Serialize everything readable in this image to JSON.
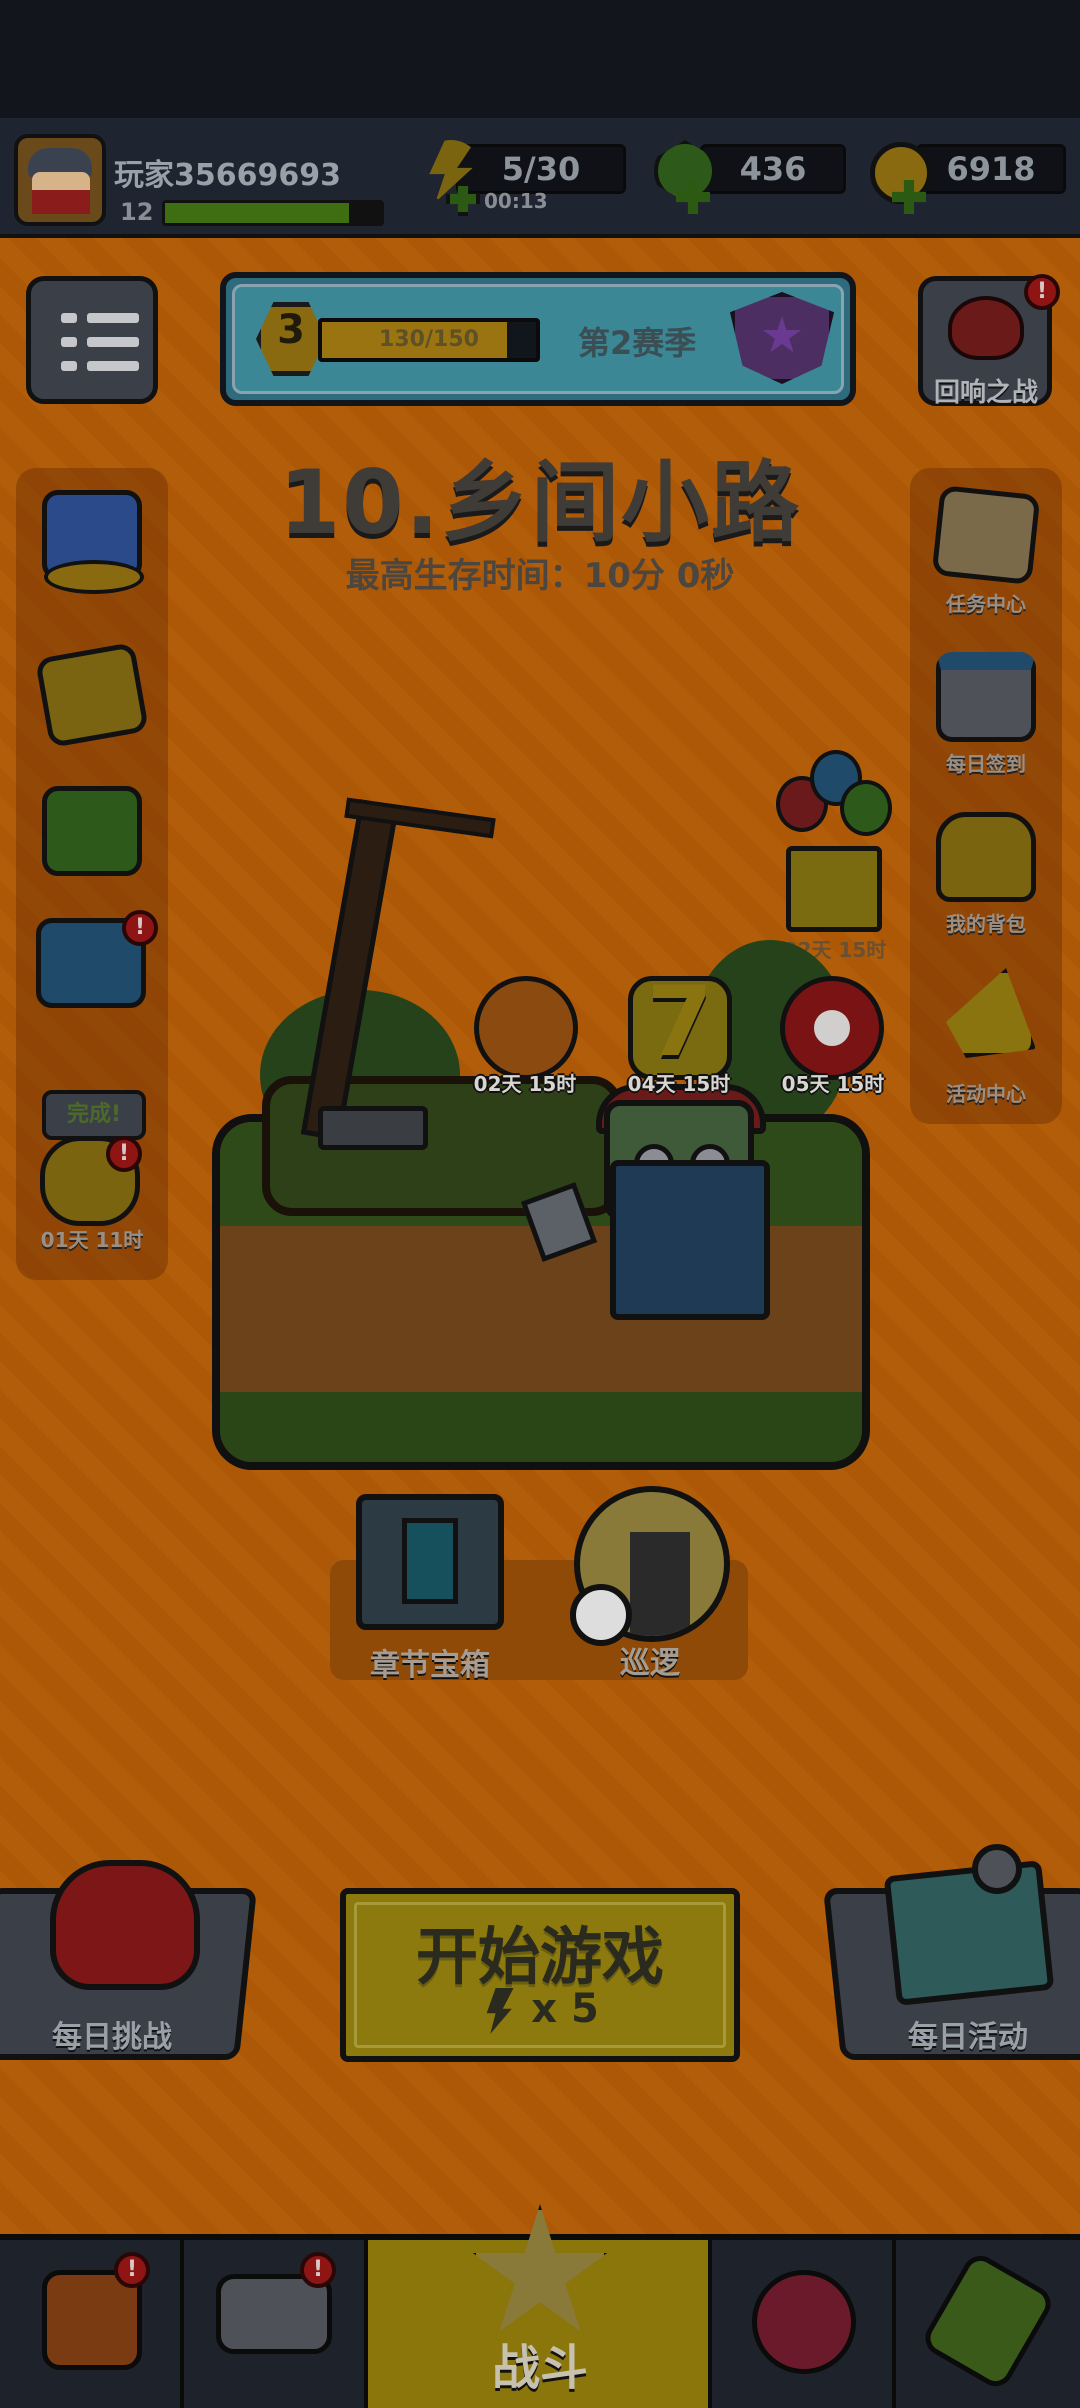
{
  "player": {
    "name": "玩家35669693",
    "level": "12",
    "xp_fraction": 0.85
  },
  "resources": {
    "energy": "5/30",
    "energy_timer": "00:13",
    "gems": "436",
    "coins": "6918"
  },
  "season": {
    "rank": "3",
    "progress_text": "130/150",
    "progress_fraction": 0.8667,
    "label": "第2赛季"
  },
  "echo_battle": {
    "label": "回响之战",
    "alert": "!"
  },
  "stage": {
    "title": "10.乡间小路",
    "best_time": "最高生存时间：10分 0秒"
  },
  "left_sidebar": {
    "items": [
      {
        "icon": "gift-coins-icon"
      },
      {
        "icon": "m-card-icon"
      },
      {
        "icon": "gem-upgrade-icon"
      },
      {
        "icon": "shop-cart-icon",
        "alert": "!"
      },
      {
        "icon": "piggy-bank-icon",
        "bubble": "完成!",
        "timer": "01天 11时",
        "alert": "!"
      }
    ]
  },
  "right_sidebar": {
    "items": [
      {
        "label": "任务中心",
        "icon": "task-scroll-icon"
      },
      {
        "label": "每日签到",
        "icon": "calendar-check-icon"
      },
      {
        "label": "我的背包",
        "icon": "backpack-icon"
      },
      {
        "label": "活动中心",
        "icon": "megaphone-icon"
      }
    ],
    "balloon_timer": "02天 15时"
  },
  "events": [
    {
      "label": "02天 15时",
      "icon": "hero-food-event-icon",
      "color": "#8a4a10"
    },
    {
      "label": "04天 15时",
      "icon": "lucky-seven-event-icon",
      "color": "#7a6a10"
    },
    {
      "label": "05天 15时",
      "icon": "target-event-icon",
      "color": "#7a1414"
    }
  ],
  "chapter_chest": {
    "label": "章节宝箱"
  },
  "patrol": {
    "label": "巡逻"
  },
  "daily_challenge": {
    "label": "每日挑战"
  },
  "start_game": {
    "label": "开始游戏",
    "cost": "x 5"
  },
  "daily_activity": {
    "label": "每日活动"
  },
  "bottom_nav": {
    "tabs": [
      {
        "icon": "shop-stall-icon",
        "alert": "!"
      },
      {
        "icon": "weapon-gun-icon",
        "alert": "!"
      },
      {
        "icon": "battle-star-icon",
        "label": "战斗",
        "active": true
      },
      {
        "icon": "talent-ball-icon"
      },
      {
        "icon": "dna-evolution-icon"
      }
    ]
  },
  "colors": {
    "background": "#b25b08",
    "topbar": "#1e2430",
    "start_button": "#8c7a0e",
    "alert": "#8f1515"
  }
}
